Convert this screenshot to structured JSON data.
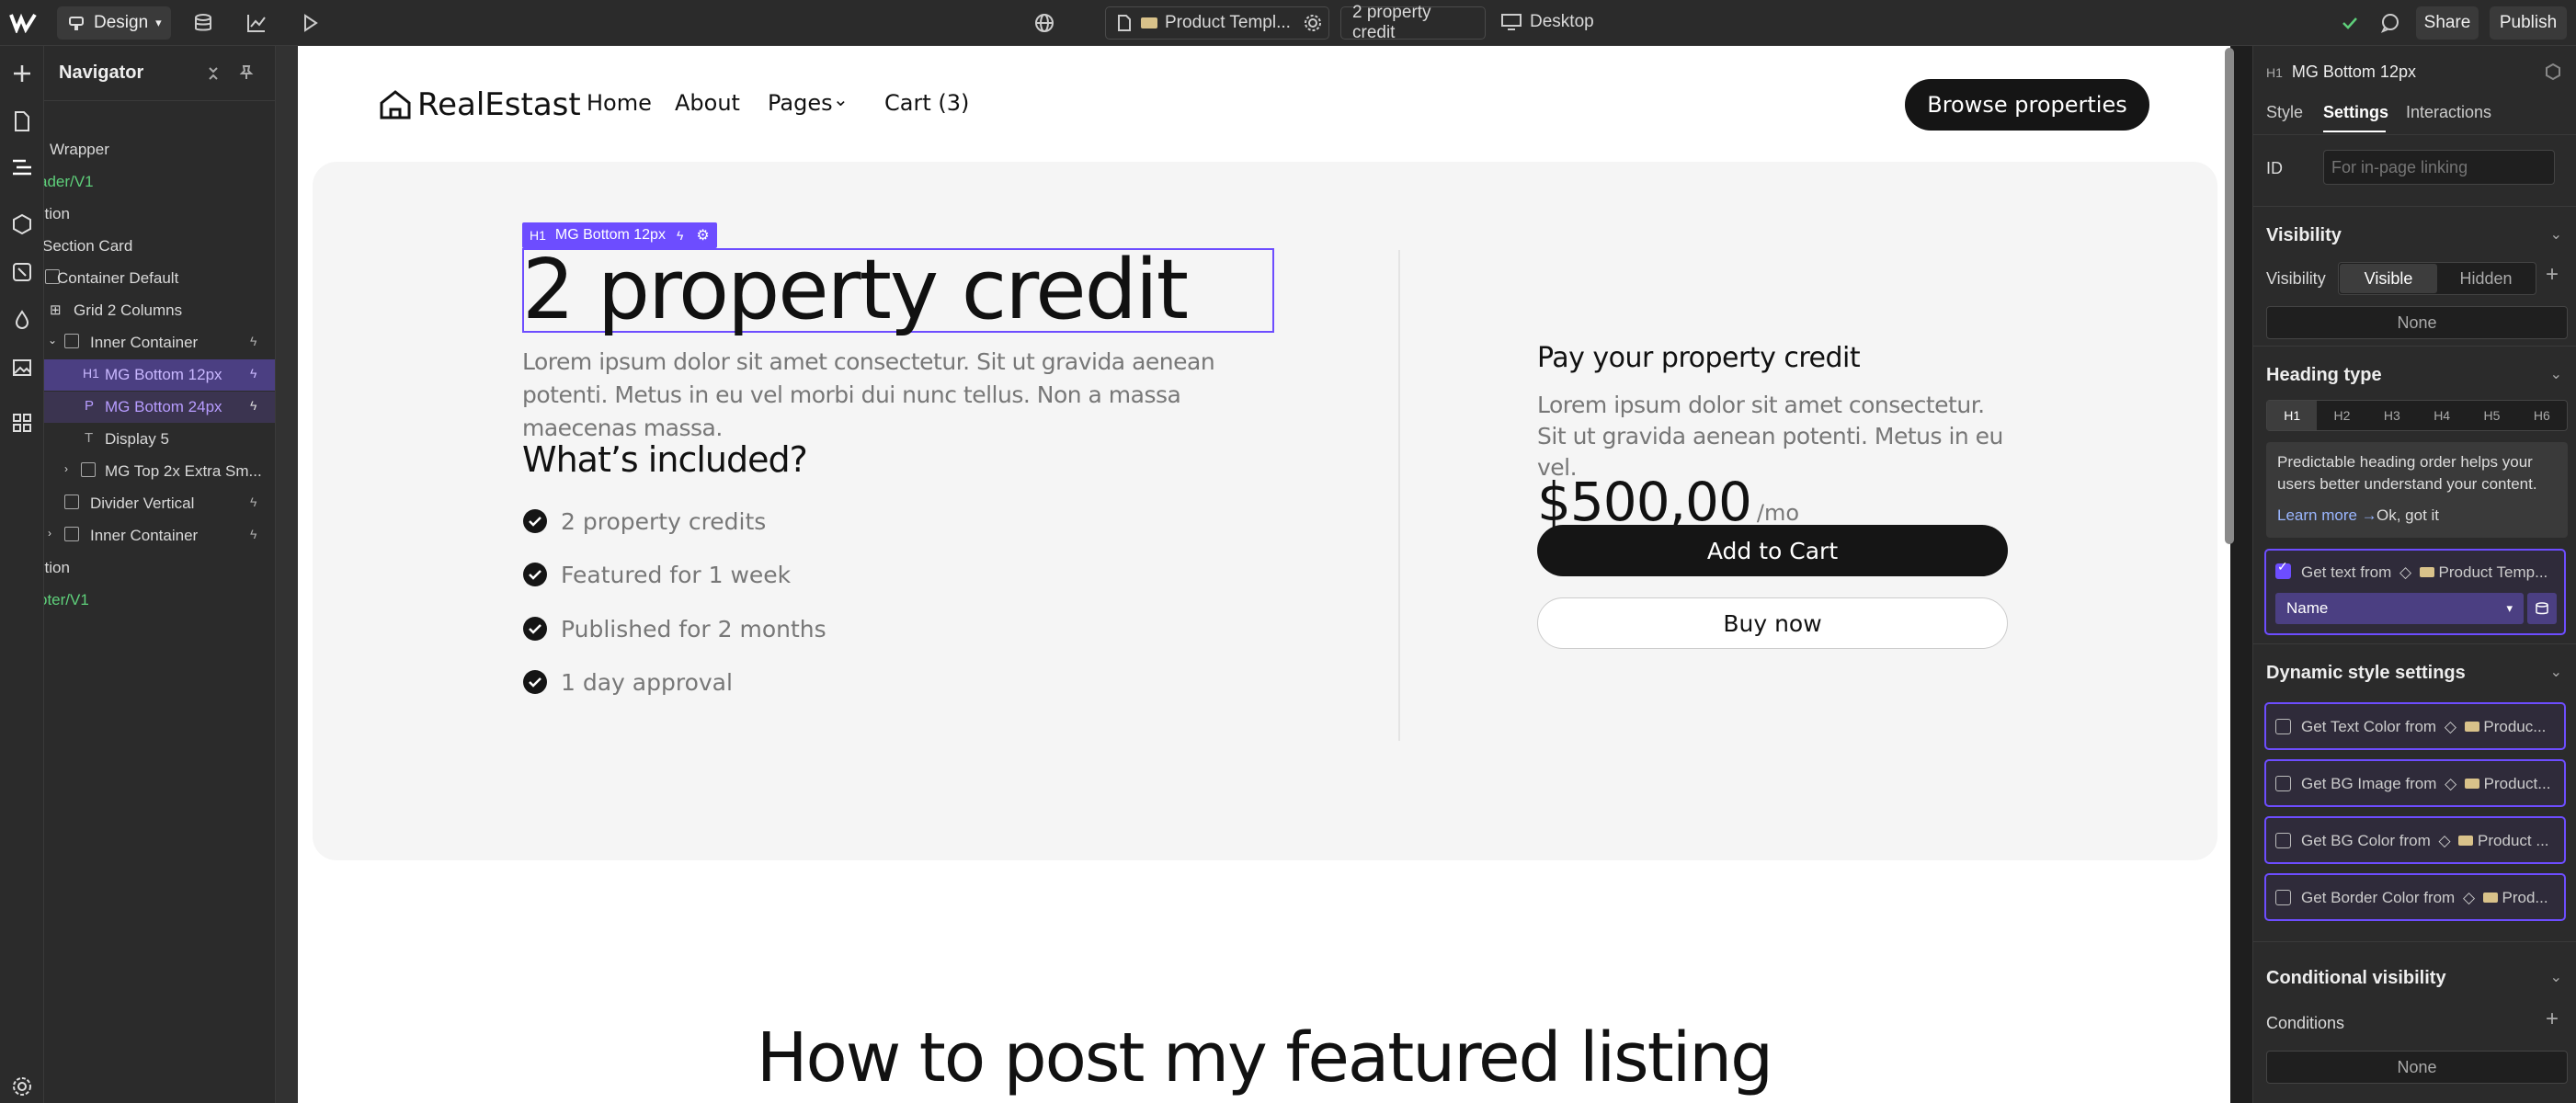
{
  "topbar": {
    "mode_label": "Design",
    "tab_product": "Product Templ...",
    "tab_item": "2 property credit",
    "device_label": "Desktop",
    "share_label": "Share",
    "publish_label": "Publish"
  },
  "navigator": {
    "title": "Navigator",
    "items": [
      {
        "label": "Wrapper",
        "kind": "box"
      },
      {
        "label": "ader/V1",
        "kind": "component"
      },
      {
        "label": "ction",
        "kind": "plain"
      },
      {
        "label": "Section Card",
        "kind": "plain"
      },
      {
        "label": "Container Default",
        "kind": "plain"
      },
      {
        "label": "Grid 2 Columns",
        "kind": "grid"
      },
      {
        "label": "Inner Container",
        "kind": "box"
      },
      {
        "label": "MG Bottom 12px",
        "kind": "heading",
        "tag": "H1"
      },
      {
        "label": "MG Bottom 24px",
        "kind": "para",
        "tag": "P"
      },
      {
        "label": "Display 5",
        "kind": "text",
        "tag": "T"
      },
      {
        "label": "MG Top 2x Extra Sm...",
        "kind": "box"
      },
      {
        "label": "Divider Vertical",
        "kind": "box"
      },
      {
        "label": "Inner Container",
        "kind": "box"
      },
      {
        "label": "ction",
        "kind": "plain"
      },
      {
        "label": "oter/V1",
        "kind": "component"
      }
    ]
  },
  "site": {
    "logo": "RealEstast",
    "nav": {
      "home": "Home",
      "about": "About",
      "pages": "Pages",
      "cart": "Cart (3)"
    },
    "cta": "Browse properties",
    "badge_tag": "H1",
    "badge_label": "MG Bottom 12px",
    "title": "2 property credit",
    "intro": "Lorem ipsum dolor sit amet consectetur. Sit ut gravida aenean potenti. Metus in eu vel morbi dui nunc tellus. Non a massa maecenas massa.",
    "included_title": "What’s included?",
    "included": [
      "2 property credits",
      "Featured for 1 week",
      "Published for 2 months",
      "1 day approval"
    ],
    "pay_title": "Pay your property credit",
    "pay_text": "Lorem ipsum dolor sit amet consectetur. Sit ut gravida aenean potenti. Metus in eu vel.",
    "price": "$500,00",
    "price_suffix": "/mo",
    "add_to_cart": "Add to Cart",
    "buy_now": "Buy now",
    "next_heading": "How to post my featured listing"
  },
  "panel": {
    "element_tag": "H1",
    "element_name": "MG Bottom 12px",
    "tabs": {
      "style": "Style",
      "settings": "Settings",
      "interactions": "Interactions"
    },
    "id_label": "ID",
    "id_placeholder": "For in-page linking",
    "visibility_title": "Visibility",
    "visibility_label": "Visibility",
    "visible": "Visible",
    "hidden": "Hidden",
    "none": "None",
    "heading_type_title": "Heading type",
    "heading_levels": [
      "H1",
      "H2",
      "H3",
      "H4",
      "H5",
      "H6"
    ],
    "hint": "Predictable heading order helps your users better understand your content.",
    "learn_more": "Learn more →",
    "ok_got_it": "Ok, got it",
    "get_text_from": "Get text from",
    "source_name": "Product Temp...",
    "field_name": "Name",
    "dynamic_title": "Dynamic style settings",
    "dynamic_items": [
      {
        "label": "Get Text Color from",
        "source": "Produc..."
      },
      {
        "label": "Get BG Image from",
        "source": "Product..."
      },
      {
        "label": "Get BG Color from",
        "source": "Product ..."
      },
      {
        "label": "Get Border Color from",
        "source": "Prod..."
      }
    ],
    "conditional_title": "Conditional visibility",
    "conditions_label": "Conditions",
    "conditions_value": "None"
  },
  "colors": {
    "accent": "#6d4dff",
    "selection": "#4b3f82",
    "component_green": "#5ecf7a",
    "page_bg": "#f5f5f5"
  }
}
